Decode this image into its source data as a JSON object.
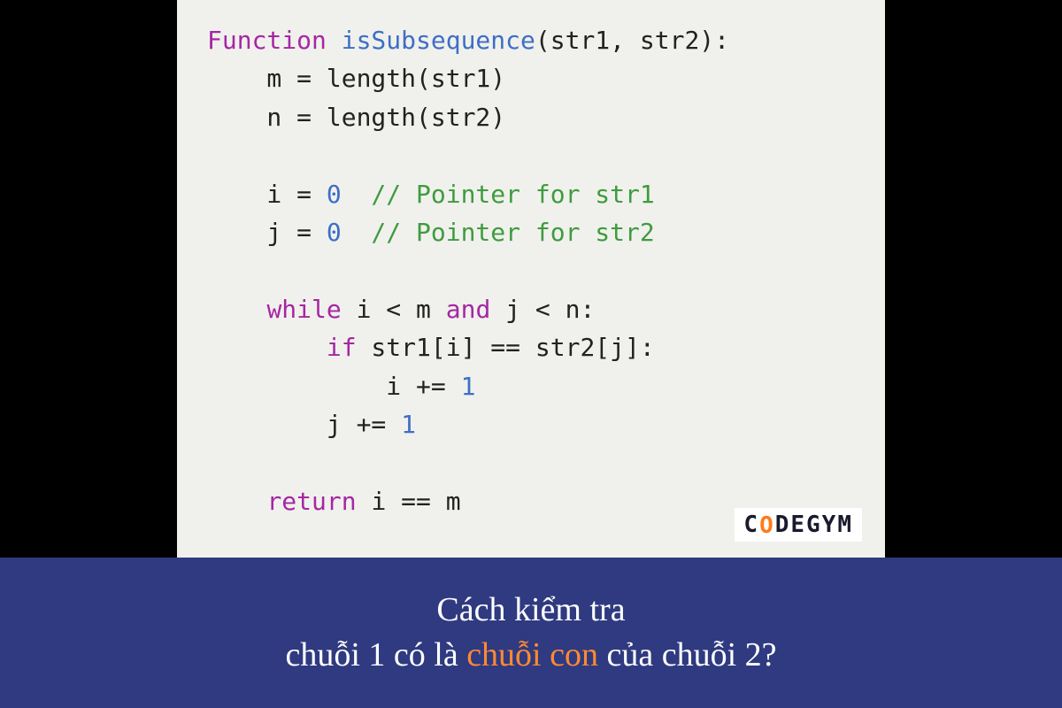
{
  "code": {
    "kw_function": "Function",
    "fn_name": "isSubsequence",
    "params_open": "(str1, str2):",
    "line_m": "    m = length(str1)",
    "line_n": "    n = length(str2)",
    "i_lhs": "    i = ",
    "zero0": "0",
    "cm_i": "  // Pointer for str1",
    "j_lhs": "    j = ",
    "zero1": "0",
    "cm_j": "  // Pointer for str2",
    "kw_while": "while",
    "while_rest": " i < m ",
    "kw_and": "and",
    "while_tail": " j < n:",
    "kw_if": "if",
    "if_rest": " str1[i] == str2[j]:",
    "i_inc_lhs": "            i += ",
    "one0": "1",
    "j_inc_lhs": "        j += ",
    "one1": "1",
    "kw_return": "return",
    "return_rest": " i == m"
  },
  "logo": {
    "pre": "C",
    "slash": "O",
    "post": "DEGYM"
  },
  "caption": {
    "line1": "Cách kiểm tra",
    "l2a": "chuỗi 1 có là ",
    "l2hl": "chuỗi con",
    "l2b": " của chuỗi 2?"
  }
}
